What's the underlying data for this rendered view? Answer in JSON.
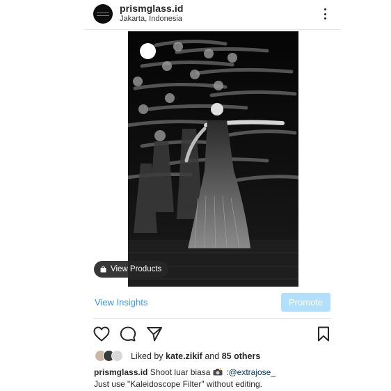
{
  "header": {
    "username": "prismglass.id",
    "location": "Jakarta, Indonesia",
    "more_icon": "more-vertical-icon"
  },
  "post": {
    "image_alt": "black and white multiple-exposure photo of a dancer",
    "view_products_label": "View Products",
    "bag_icon": "shopping-bag-icon"
  },
  "insights": {
    "view_insights_label": "View Insights",
    "promote_label": "Promote",
    "promote_color": "#b2dffc",
    "link_color": "#3897f0"
  },
  "actions": {
    "like_icon": "heart-icon",
    "comment_icon": "comment-icon",
    "share_icon": "send-icon",
    "save_icon": "bookmark-icon"
  },
  "likes": {
    "prefix": "Liked by",
    "user": "kate.zikif",
    "joiner": "and",
    "others": "85 others"
  },
  "caption": {
    "username": "prismglass.id",
    "text": "Shoot luar biasa",
    "emoji_icon": "camera-with-flash-icon",
    "mention": ":@extrajose_",
    "line2": "Just use \"Kaleidoscope Filter\" without editing."
  }
}
